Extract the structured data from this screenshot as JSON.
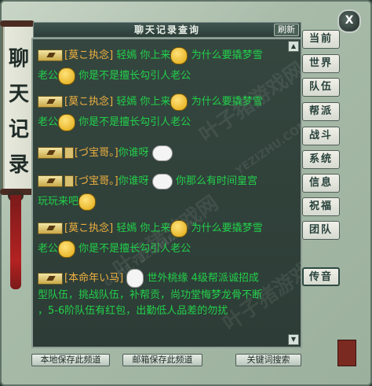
{
  "window": {
    "title": "聊天记录查询",
    "refresh_label": "刷新",
    "close_label": "X"
  },
  "banner": {
    "chars": [
      "聊",
      "天",
      "记",
      "录"
    ]
  },
  "watermarks": [
    "叶子猪游戏网",
    "YEZIZHU.COM",
    "叶子猪游戏网",
    "GAME.YEZIZHU.COM",
    "叶子猪游戏网"
  ],
  "messages": [
    {
      "name": "[莫こ执念]",
      "text_a": "轻嫣 你上来",
      "text_b": "为什么要撬梦雪",
      "line2_a": "老公",
      "line2_b": "你是不是擅长勾引人老公",
      "emote1": "smiley-face",
      "emote2": "smiley-face"
    },
    {
      "name": "[莫こ执念]",
      "text_a": "轻嫣 你上来",
      "text_b": "为什么要撬梦雪",
      "line2_a": "老公",
      "line2_b": "你是不是擅长勾引人老公",
      "emote1": "smiley-face",
      "emote2": "smiley-face"
    },
    {
      "name": "[づ宝哥。]",
      "text_a": "你谁呀",
      "emote1": "white-blob-face"
    },
    {
      "name": "[づ宝哥。]",
      "text_a": "你谁呀",
      "text_b": "你那么有时间皇宫",
      "line2_a": "玩玩来吧",
      "emote1": "white-blob-face",
      "emote2": "smiley-face"
    },
    {
      "name": "[莫こ执念]",
      "text_a": "轻嫣 你上来",
      "text_b": "为什么要撬梦雪",
      "line2_a": "老公",
      "line2_b": "你是不是擅长勾引人老公",
      "emote1": "smiley-face",
      "emote2": "smiley-face"
    },
    {
      "name": "[本命年い马]",
      "text_a": "世外桃缘 4级帮派诚招成",
      "line2_a": "型队伍，挑战队伍，补帮贡，尚功堂悔梦龙骨不断",
      "line3_a": "，5-6阶队伍有红包，出勤低人品差的勿扰",
      "emote1": "bunny-face"
    }
  ],
  "tabs": [
    "当前",
    "世界",
    "队伍",
    "帮派",
    "战斗",
    "系统",
    "信息",
    "祝福",
    "团队",
    "传音"
  ],
  "bottom_buttons": [
    "本地保存此频道",
    "邮箱保存此频道",
    "关键词搜索"
  ],
  "colors": {
    "chat_text": "#22d04a",
    "name_text": "#f0b040",
    "panel_bg": "#2d3c36"
  }
}
